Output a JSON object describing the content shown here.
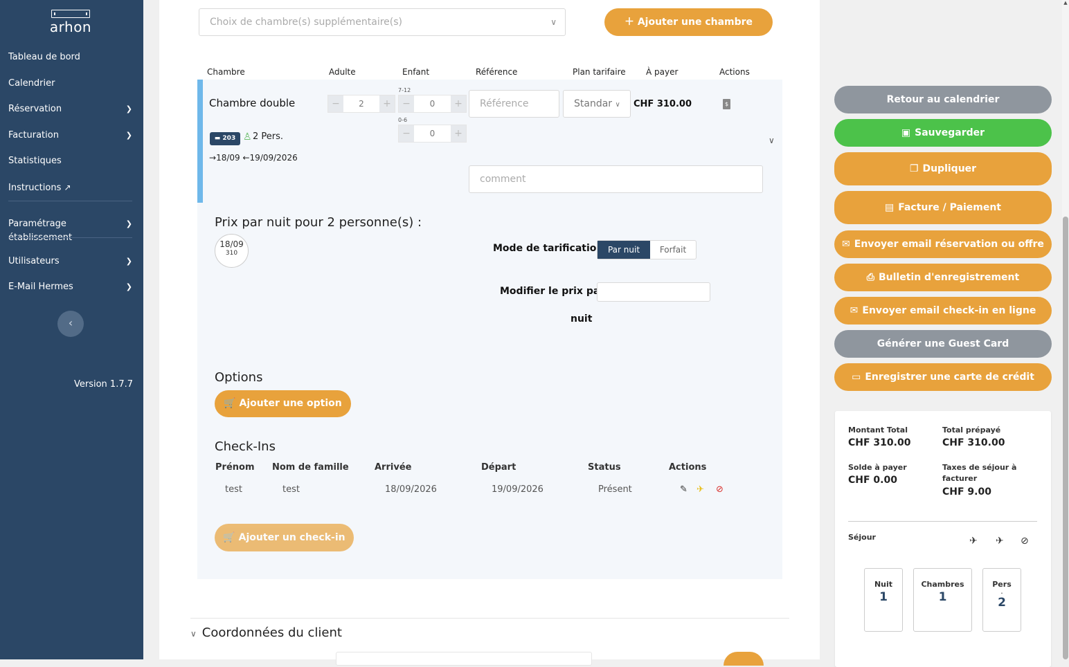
{
  "sidebar": {
    "logo_text": "arhon",
    "items": [
      {
        "label": "Tableau de bord"
      },
      {
        "label": "Calendrier"
      },
      {
        "label": "Réservation"
      },
      {
        "label": "Facturation"
      },
      {
        "label": "Statistiques"
      },
      {
        "label": "Instructions"
      },
      {
        "label": "Paramétrage établissement"
      },
      {
        "label": "Utilisateurs"
      },
      {
        "label": "E-Mail Hermes"
      }
    ],
    "version": "Version 1.7.7"
  },
  "rooms": {
    "select_placeholder": "Choix de chambre(s) supplémentaire(s)",
    "add_room_label": "Ajouter une chambre",
    "headers": [
      "Chambre",
      "Adulte",
      "Enfant",
      "Référence",
      "Plan tarifaire",
      "À payer",
      "Actions"
    ],
    "room": {
      "title": "Chambre double",
      "badge": "203",
      "pers": "2 Pers.",
      "arrival": "18/09",
      "departure": "19/09/2026",
      "adults": "2",
      "child_label_1": "7-12",
      "child_value_1": "0",
      "child_label_2": "0-6",
      "child_value_2": "0",
      "reference_placeholder": "Référence",
      "rate_plan": "Standar",
      "amount": "CHF 310.00",
      "comment_placeholder": "comment"
    },
    "price": {
      "heading": "Prix par nuit pour 2 personne(s) :",
      "date": "18/09",
      "price": "310",
      "mode_label": "Mode de tarification",
      "mode_on": "Par nuit",
      "mode_off": "Forfait",
      "modify_label_1": "Modifier le prix par",
      "modify_label_2": "nuit"
    },
    "options": {
      "heading": "Options",
      "add_label": "Ajouter une option"
    },
    "checkins": {
      "heading": "Check-Ins",
      "headers": [
        "Prénom",
        "Nom de famille",
        "Arrivée",
        "Départ",
        "Status",
        "Actions"
      ],
      "row": {
        "first": "test",
        "last": "test",
        "arrival": "18/09/2026",
        "departure": "19/09/2026",
        "status": "Présent"
      },
      "add_label": "Ajouter un check-in"
    },
    "client_heading": "Coordonnées du client"
  },
  "actions": {
    "back": "Retour au calendrier",
    "save": "Sauvegarder",
    "duplicate": "Dupliquer",
    "invoice": "Facture / Paiement",
    "send_email": "Envoyer email réservation ou offre",
    "bulletin": "Bulletin d'enregistrement",
    "checkin_email": "Envoyer email check-in en ligne",
    "guest_card": "Générer une Guest Card",
    "credit_card": "Enregistrer une carte de crédit"
  },
  "summary": {
    "total_label": "Montant Total",
    "total": "CHF 310.00",
    "prepaid_label": "Total prépayé",
    "prepaid": "CHF 310.00",
    "balance_label": "Solde à payer",
    "balance": "CHF 0.00",
    "tax_label_1": "Taxes de séjour à",
    "tax_label_2": "facturer",
    "tax": "CHF 9.00",
    "sejour_label": "Séjour",
    "nights_label": "Nuit",
    "nights": "1",
    "rooms_label": "Chambres",
    "rooms": "1",
    "pers_label": "Pers",
    "pers_dot": ".",
    "pers": "2"
  },
  "colors": {
    "sidebar": "#2b4766",
    "orange": "#e8a23c",
    "green": "#4cc24a",
    "grey": "#8f969e",
    "accent_bar": "#6fb8ea"
  }
}
